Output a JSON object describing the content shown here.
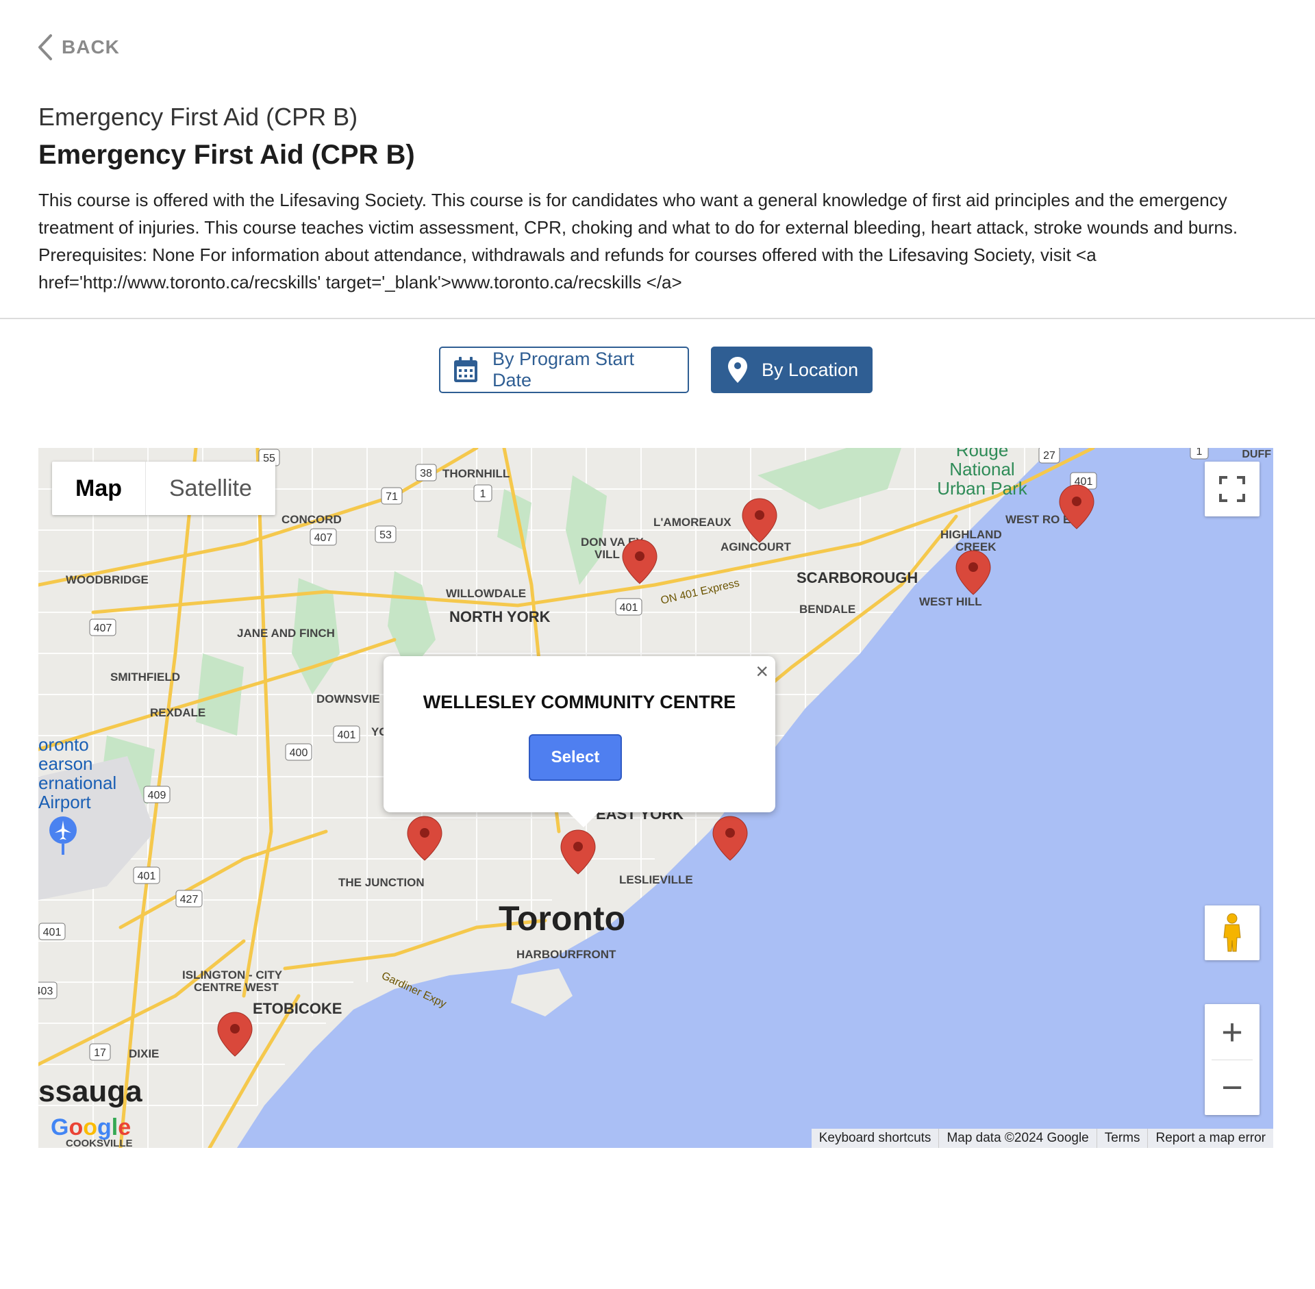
{
  "back": {
    "label": "BACK"
  },
  "course": {
    "subtitle": "Emergency First Aid (CPR B)",
    "title": "Emergency First Aid (CPR B)",
    "description": "This course is offered with the Lifesaving Society. This course is for candidates who want a general knowledge of first aid principles and the emergency treatment of injuries. This course teaches victim assessment, CPR, choking and what to do for external bleeding, heart attack, stroke wounds and burns. Prerequisites: None For information about attendance, withdrawals and refunds for courses offered with the Lifesaving Society, visit <a href='http://www.toronto.ca/recskills' target='_blank'>www.toronto.ca/recskills </a>"
  },
  "view_tabs": {
    "by_date": "By Program Start Date",
    "by_location": "By Location",
    "active": "by_location"
  },
  "map": {
    "type_map": "Map",
    "type_satellite": "Satellite",
    "zoom_in": "+",
    "zoom_out": "−",
    "popup": {
      "name": "WELLESLEY COMMUNITY CENTRE",
      "select_label": "Select"
    },
    "attribution": {
      "shortcuts": "Keyboard shortcuts",
      "data": "Map data ©2024 Google",
      "terms": "Terms",
      "report": "Report a map error"
    },
    "logo": "Google",
    "colors": {
      "water": "#aabff5",
      "park": "#c6e5c6",
      "highway": "#f5c84c",
      "marker": "#d9483b",
      "accent": "#2f5e93"
    },
    "labels": {
      "toronto": "Toronto",
      "north_york": "NORTH YORK",
      "scarborough": "SCARBOROUGH",
      "etobicoke": "ETOBICOKE",
      "east_york": "EAST YORK",
      "thornhill": "THORNHILL",
      "concord": "CONCORD",
      "woodbridge": "WOODBRIDGE",
      "willowdale": "WILLOWDALE",
      "jane_finch": "JANE AND FINCH",
      "smithfield": "SMITHFIELD",
      "rexdale": "REXDALE",
      "downsview": "DOWNSVIE",
      "lamoreaux": "L'AMOREAUX",
      "agincourt": "AGINCOURT",
      "don_valley": "DON VA   EY",
      "don_valley2": "VILL",
      "highland": "HIGHLAND",
      "creek": "CREEK",
      "west_rouge": "WEST RO    E",
      "bendale": "BENDALE",
      "west_hill": "WEST HILL",
      "junction": "THE JUNCTION",
      "leslieville": "LESLIEVILLE",
      "harbourfront": "HARBOURFRONT",
      "islington": "ISLINGTON - CITY",
      "centre_west": "CENTRE WEST",
      "dixie": "DIXIE",
      "mississauga": "ssauga",
      "cooksville": "COOKSVILLE",
      "rouge1": "Rouge",
      "rouge2": "National",
      "rouge3": "Urban Park",
      "airport1": "oronto",
      "airport2": "earson",
      "airport3": "ernational",
      "airport4": "Airport",
      "express": "ON 401 Express",
      "gardiner": "Gardiner Expy",
      "duff": "DUFF",
      "yo": "YC"
    },
    "shields": [
      "38",
      "71",
      "1",
      "55",
      "407",
      "53",
      "407",
      "401",
      "400",
      "409",
      "401",
      "427",
      "401",
      "403",
      "17",
      "27",
      "401",
      "1",
      "401"
    ]
  }
}
